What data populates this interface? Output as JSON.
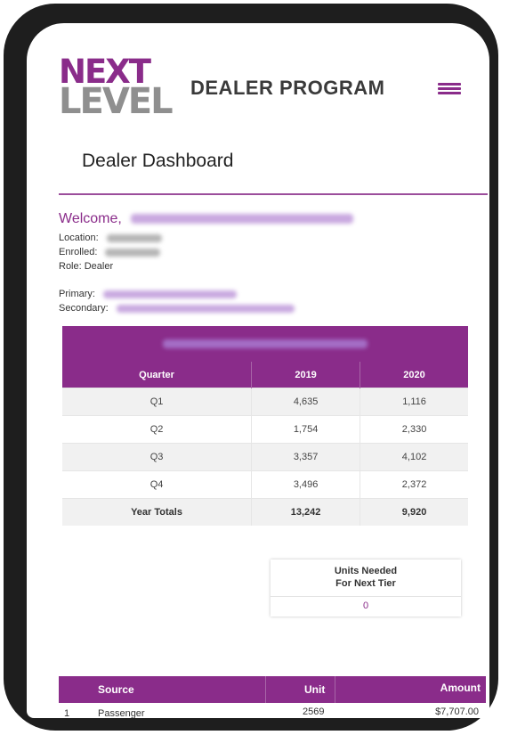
{
  "header": {
    "logo_top": "NEXT",
    "logo_bottom": "LEVEL",
    "program_title": "DEALER PROGRAM",
    "menu_icon": "hamburger-icon"
  },
  "page_title": "Dealer Dashboard",
  "welcome": {
    "greeting": "Welcome,",
    "location_label": "Location:",
    "enrolled_label": "Enrolled:",
    "role": "Role: Dealer",
    "primary_label": "Primary:",
    "secondary_label": "Secondary:"
  },
  "quarter_table": {
    "headers": [
      "Quarter",
      "2019",
      "2020"
    ],
    "rows": [
      [
        "Q1",
        "4,635",
        "1,116"
      ],
      [
        "Q2",
        "1,754",
        "2,330"
      ],
      [
        "Q3",
        "3,357",
        "4,102"
      ],
      [
        "Q4",
        "3,496",
        "2,372"
      ]
    ],
    "totals": [
      "Year Totals",
      "13,242",
      "9,920"
    ]
  },
  "units_needed": {
    "title_line1": "Units Needed",
    "title_line2": "For Next Tier",
    "value": "0"
  },
  "source_table": {
    "headers": [
      "Source",
      "Unit",
      "Amount"
    ],
    "rows": [
      [
        "1",
        "Passenger",
        "2569",
        "$7,707.00"
      ]
    ]
  },
  "colors": {
    "brand_purple": "#8a2c8a",
    "logo_grey": "#8f8f8f"
  }
}
